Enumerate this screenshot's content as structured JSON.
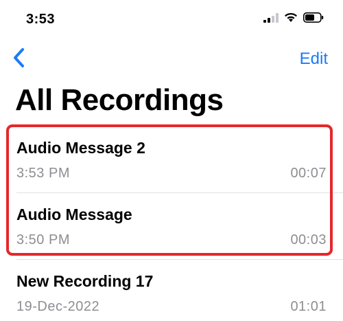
{
  "status_bar": {
    "time": "3:53",
    "icons": [
      "cellular-signal-icon",
      "wifi-icon",
      "battery-icon"
    ]
  },
  "nav": {
    "back_icon": "chevron-left-icon",
    "edit_label": "Edit"
  },
  "title": "All Recordings",
  "recordings": [
    {
      "title": "Audio Message 2",
      "date": "3:53 PM",
      "duration": "00:07"
    },
    {
      "title": "Audio Message",
      "date": "3:50 PM",
      "duration": "00:03"
    },
    {
      "title": "New Recording 17",
      "date": "19-Dec-2022",
      "duration": "01:01"
    }
  ],
  "colors": {
    "accent": "#1a7cf5",
    "secondary_text": "#8e8e93",
    "highlight": "#e5272b"
  }
}
